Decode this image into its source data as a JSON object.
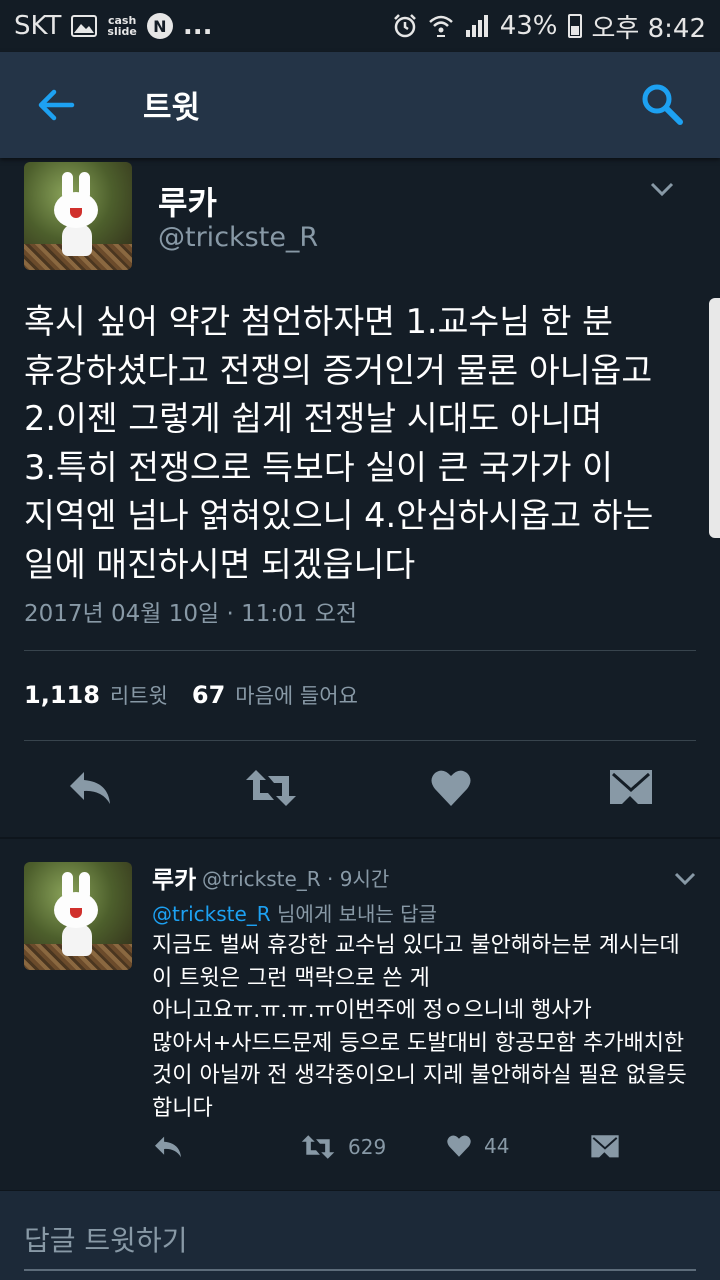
{
  "status_bar": {
    "carrier": "SKT",
    "cash_slide": "cash\nslide",
    "naver_letter": "N",
    "more": "...",
    "battery": "43%",
    "time": "오후 8:42"
  },
  "app_bar": {
    "title": "트윗"
  },
  "tweet": {
    "name": "루카",
    "handle": "@trickste_R",
    "text": "혹시 싶어 약간 첨언하자면 1.교수님 한 분\n휴강하셨다고 전쟁의 증거인거 물론 아니옵고\n2.이젠 그렇게 쉽게 전쟁날 시대도 아니며\n3.특히 전쟁으로 득보다 실이 큰 국가가 이\n지역엔 넘나 얽혀있으니 4.안심하시옵고 하는\n일에 매진하시면 되겠읍니다",
    "date": "2017년 04월 10일 · 11:01 오전",
    "retweet_count": "1,118",
    "retweet_label": "리트윗",
    "like_count": "67",
    "like_label": "마음에 들어요"
  },
  "reply": {
    "name": "루카",
    "meta": "@trickste_R · 9시간",
    "reply_to_handle": "@trickste_R",
    "reply_to_suffix": " 님에게 보내는 답글",
    "text": "지금도 벌써 휴강한 교수님 있다고 불안해하는분 계시는데\n이 트윗은 그런 맥락으로 쓴 게\n아니고요ㅠ.ㅠ.ㅠ.ㅠ이번주에 정ㅇ으니네 행사가\n많아서+사드드문제 등으로 도발대비 항공모함 추가배치한\n것이 아닐까 전 생각중이오니 지레 불안해하실 필욘 없을듯\n합니다",
    "retweet_count": "629",
    "like_count": "44"
  },
  "compose": {
    "placeholder": "답글 트윗하기"
  },
  "colors": {
    "background": "#141d26",
    "app_bar": "#243447",
    "accent": "#1da1f2",
    "secondary_text": "#8899a6",
    "divider": "#38444d"
  }
}
